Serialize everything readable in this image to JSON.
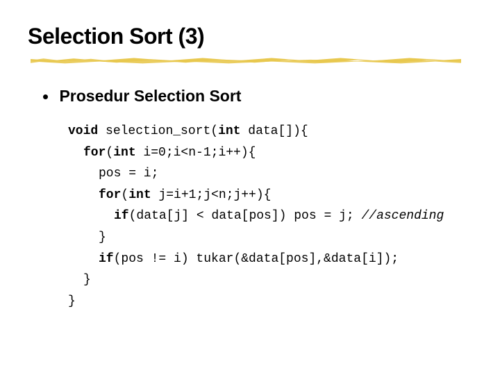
{
  "title": "Selection Sort (3)",
  "subtitle": "Prosedur Selection Sort",
  "code": {
    "l0": "void selection_sort(int data[]){",
    "l1": "for(int i=0;i<n-1;i++){",
    "l2": "pos = i;",
    "l3": "for(int j=i+1;j<n;j++){",
    "l4a": "if(data[j] < data[pos]) pos = j; ",
    "l4c": "//ascending",
    "l5": "}",
    "l6": "if(pos != i) tukar(&data[pos],&data[i]);",
    "l7": "}",
    "l8": "}"
  }
}
